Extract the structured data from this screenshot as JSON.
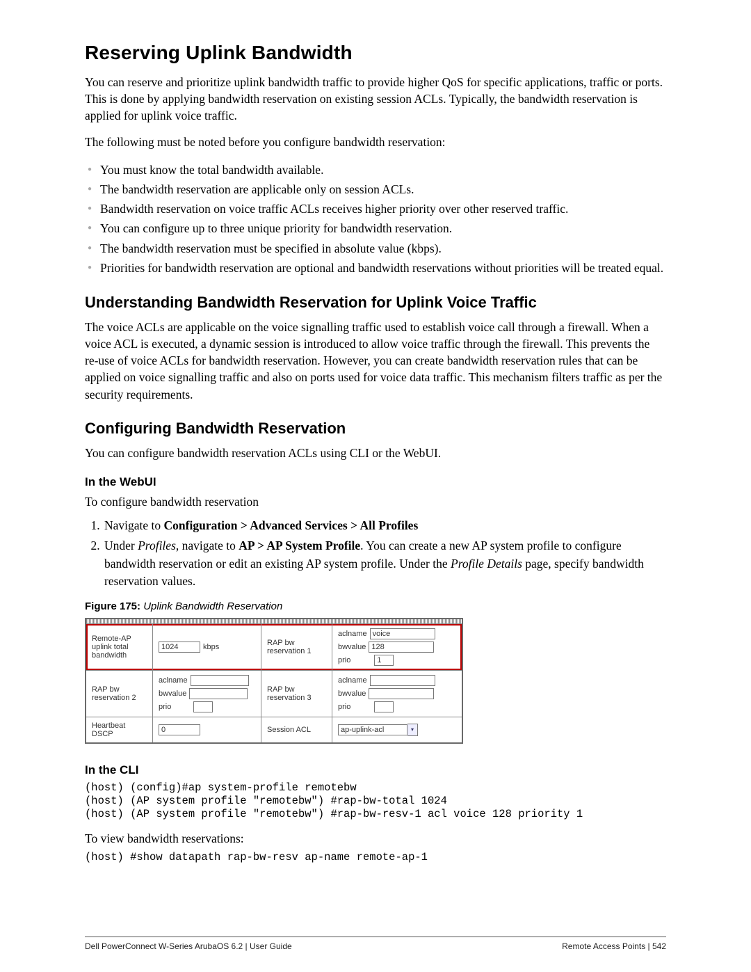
{
  "title": "Reserving Uplink Bandwidth",
  "intro": "You can reserve and prioritize uplink bandwidth traffic to provide higher QoS for specific applications, traffic or ports. This is done by applying bandwidth reservation on existing session ACLs. Typically, the bandwidth reservation is applied for uplink voice traffic.",
  "note_lead": "The following must be noted before you configure bandwidth reservation:",
  "notes": [
    "You must know the total bandwidth available.",
    "The bandwidth reservation are applicable only on session ACLs.",
    "Bandwidth reservation on voice traffic ACLs receives higher priority over other reserved traffic.",
    "You can configure up to three unique priority for bandwidth reservation.",
    "The bandwidth reservation must be specified in absolute value (kbps).",
    "Priorities for bandwidth reservation are optional and bandwidth reservations without priorities will be treated equal."
  ],
  "section_understanding": {
    "heading": "Understanding Bandwidth Reservation for Uplink Voice Traffic",
    "body": "The voice ACLs are applicable on the voice signalling traffic used to establish voice call through a firewall. When a voice ACL is executed, a dynamic session is introduced to allow voice traffic through the firewall. This prevents the re-use of voice ACLs for bandwidth reservation. However, you can create bandwidth reservation rules that can be applied on voice signalling traffic and also on ports used for voice data traffic. This mechanism filters traffic as per the security requirements."
  },
  "section_config": {
    "heading": "Configuring Bandwidth Reservation",
    "body": "You can configure bandwidth reservation ACLs using CLI or the WebUI."
  },
  "webui": {
    "heading": "In the WebUI",
    "lead": "To configure bandwidth reservation",
    "step1_pre": "Navigate to ",
    "step1_bold": "Configuration > Advanced Services > All Profiles",
    "step2_a": "Under ",
    "step2_b_i": "Profiles",
    "step2_c": ", navigate to ",
    "step2_d_bold": "AP > AP System Profile",
    "step2_e": ". You can create a new AP system profile to configure bandwidth reservation or edit an existing AP system profile. Under the ",
    "step2_f_i": "Profile Details",
    "step2_g": " page, specify bandwidth reservation values."
  },
  "figure": {
    "label": "Figure 175:",
    "title": " Uplink Bandwidth Reservation",
    "rows": {
      "r1": {
        "labelA": "Remote-AP uplink total bandwidth",
        "valA_value": "1024",
        "valA_unit": "kbps",
        "labelB": "RAP bw reservation 1",
        "kv": {
          "aclname": "voice",
          "bwvalue": "128",
          "prio": "1"
        }
      },
      "r2": {
        "labelA": "RAP bw reservation 2",
        "kvA": {
          "aclname": "",
          "bwvalue": "",
          "prio": ""
        },
        "labelB": "RAP bw reservation 3",
        "kvB": {
          "aclname": "",
          "bwvalue": "",
          "prio": ""
        }
      },
      "r3": {
        "labelA": "Heartbeat DSCP",
        "valA": "0",
        "labelB": "Session ACL",
        "select": "ap-uplink-acl"
      }
    },
    "field_labels": {
      "aclname": "aclname",
      "bwvalue": "bwvalue",
      "prio": "prio"
    }
  },
  "cli": {
    "heading": "In the CLI",
    "block1": "(host) (config)#ap system-profile remotebw\n(host) (AP system profile \"remotebw\") #rap-bw-total 1024\n(host) (AP system profile \"remotebw\") #rap-bw-resv-1 acl voice 128 priority 1",
    "view_lead": "To view bandwidth reservations:",
    "block2": "(host) #show datapath rap-bw-resv ap-name remote-ap-1"
  },
  "footer": {
    "left": "Dell PowerConnect W-Series ArubaOS 6.2 | User Guide",
    "right": "Remote Access Points | 542"
  }
}
